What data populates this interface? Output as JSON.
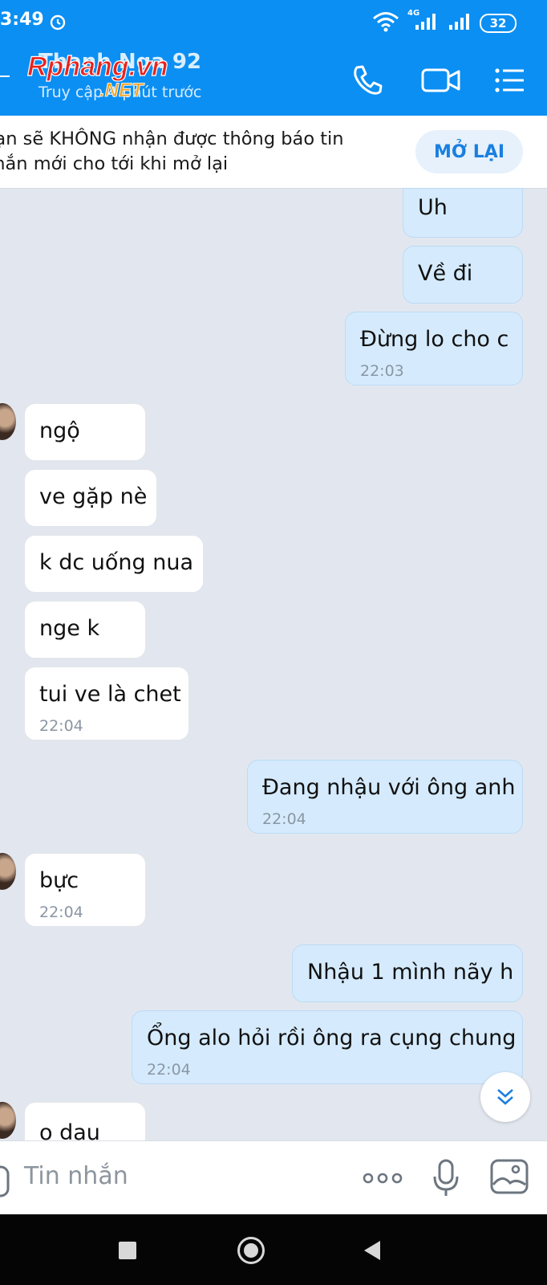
{
  "status_bar": {
    "time": "3:49",
    "network": "4G",
    "battery": "32"
  },
  "header": {
    "contact_name": "Thanh Nga 92",
    "status": "Truy cập 4 phút trước",
    "watermark_brand": "Rphang.vn",
    "watermark_sub": ".NET"
  },
  "banner": {
    "text": "Bạn sẽ KHÔNG nhận được thông báo tin\nnhắn mới cho tới khi mở lại",
    "button": "MỞ LẠI"
  },
  "messages": [
    {
      "dir": "out",
      "text": "Uh",
      "time": ""
    },
    {
      "dir": "out",
      "text": "Về đi",
      "time": ""
    },
    {
      "dir": "out",
      "text": "Đừng lo cho c",
      "time": "22:03"
    },
    {
      "dir": "in",
      "text": "ngộ",
      "time": ""
    },
    {
      "dir": "in",
      "text": "ve gặp nè",
      "time": ""
    },
    {
      "dir": "in",
      "text": "k dc uống nua",
      "time": ""
    },
    {
      "dir": "in",
      "text": "nge k",
      "time": ""
    },
    {
      "dir": "in",
      "text": "tui ve là chet",
      "time": "22:04"
    },
    {
      "dir": "out",
      "text": "Đang nhậu với ông anh",
      "time": "22:04"
    },
    {
      "dir": "in",
      "text": "bực",
      "time": "22:04"
    },
    {
      "dir": "out",
      "text": "Nhậu 1 mình nãy h",
      "time": ""
    },
    {
      "dir": "out",
      "text": "Ổng alo hỏi rồi ông ra cụng chung",
      "time": "22:04"
    },
    {
      "dir": "in",
      "text": "o dau",
      "time": ""
    }
  ],
  "composer": {
    "placeholder": "Tin nhắn"
  },
  "colors": {
    "header": "#0b8ff3",
    "outgoing_bubble": "#d5ebfd",
    "incoming_bubble": "#ffffff",
    "chat_bg": "#e2e7ef"
  }
}
